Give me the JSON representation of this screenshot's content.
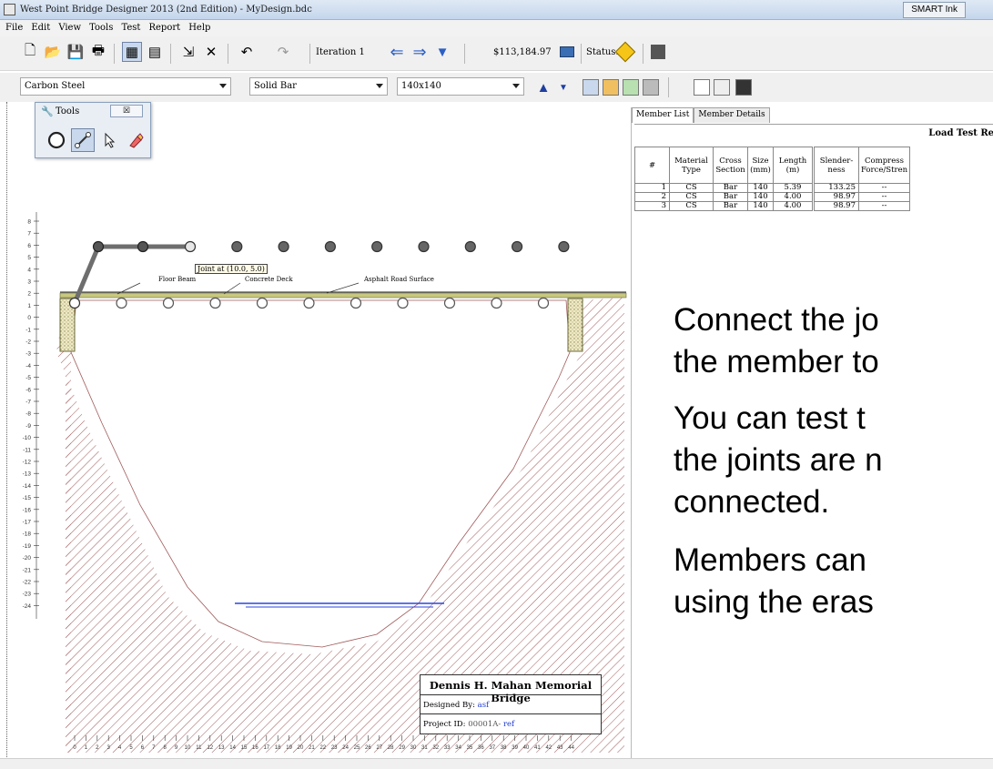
{
  "window": {
    "title": "West Point Bridge Designer 2013 (2nd Edition) - MyDesign.bdc",
    "smart_ink": "SMART Ink"
  },
  "menu": [
    "File",
    "Edit",
    "View",
    "Tools",
    "Test",
    "Report",
    "Help"
  ],
  "toolbar": {
    "iteration": "Iteration 1",
    "cost": "$113,184.97",
    "status_label": "Status:"
  },
  "selectors": {
    "material": "Carbon Steel",
    "section": "Solid Bar",
    "size": "140x140"
  },
  "tools_palette": {
    "title": "Tools",
    "close": "☒"
  },
  "tabs": [
    "Member List",
    "Member Details"
  ],
  "member_table": {
    "header_title": "Load Test Re",
    "columns": [
      "#",
      "Material Type",
      "Cross Section",
      "Size (mm)",
      "Length (m)",
      "Slender-ness",
      "Compress Force/Stren"
    ],
    "rows": [
      [
        "1",
        "CS",
        "Bar",
        "140",
        "5.39",
        "133.25",
        "--"
      ],
      [
        "2",
        "CS",
        "Bar",
        "140",
        "4.00",
        "98.97",
        "--"
      ],
      [
        "3",
        "CS",
        "Bar",
        "140",
        "4.00",
        "98.97",
        "--"
      ]
    ]
  },
  "drawing": {
    "tooltip": "Joint at (10.0, 5.0)",
    "labels": {
      "floor_beam": "Floor Beam",
      "deck": "Concrete Deck",
      "road": "Asphalt Road Surface"
    },
    "y_ticks": [
      "8",
      "7",
      "6",
      "5",
      "4",
      "3",
      "2",
      "1",
      "0",
      "-1",
      "-2",
      "-3",
      "-4",
      "-5",
      "-6",
      "-7",
      "-8",
      "-9",
      "-10",
      "-11",
      "-12",
      "-13",
      "-14",
      "-15",
      "-16",
      "-17",
      "-18",
      "-19",
      "-20",
      "-21",
      "-22",
      "-23",
      "-24"
    ],
    "x_ticks": [
      "0",
      "1",
      "2",
      "3",
      "4",
      "5",
      "6",
      "7",
      "8",
      "9",
      "10",
      "11",
      "12",
      "13",
      "14",
      "15",
      "16",
      "17",
      "18",
      "19",
      "20",
      "21",
      "22",
      "23",
      "24",
      "25",
      "26",
      "27",
      "28",
      "29",
      "30",
      "31",
      "32",
      "33",
      "34",
      "35",
      "36",
      "37",
      "38",
      "39",
      "40",
      "41",
      "42",
      "43",
      "44"
    ]
  },
  "title_block": {
    "bridge_name": "Dennis H. Mahan Memorial Bridge",
    "designed_by_label": "Designed By:",
    "designed_by": "asf",
    "project_id_label": "Project ID:",
    "project_id": "00001A-",
    "project_ref": "ref"
  },
  "notes": [
    "Connect the jo",
    "the member to",
    "You can test t",
    "the joints are n",
    "connected.",
    "Members can",
    "using the eras"
  ],
  "colors": {
    "member": "#6e6e6e",
    "terrain_hatch": "#a05a5a",
    "deck": "#c8c880",
    "water": "#2b46e0",
    "link_blue": "#1f3bd0"
  }
}
